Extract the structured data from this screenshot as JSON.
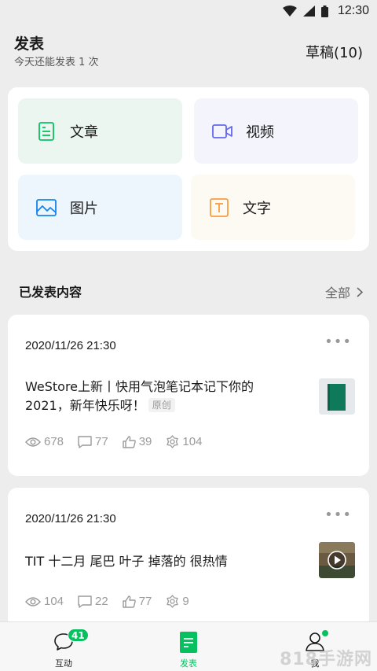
{
  "status_bar": {
    "time": "12:30"
  },
  "header": {
    "title": "发表",
    "subtitle": "今天还能发表 1 次",
    "drafts": "草稿(10)"
  },
  "publish_types": [
    {
      "label": "文章",
      "icon": "article-icon",
      "color": "#07c160"
    },
    {
      "label": "视频",
      "icon": "video-icon",
      "color": "#6467f0"
    },
    {
      "label": "图片",
      "icon": "image-icon",
      "color": "#1485ee"
    },
    {
      "label": "文字",
      "icon": "text-icon",
      "color": "#fa9d3b"
    }
  ],
  "published_section": {
    "title": "已发表内容",
    "view_all": "全部"
  },
  "posts": [
    {
      "date": "2020/11/26 21:30",
      "title": "WeStore上新丨快用气泡笔记本记下你的2021，新年快乐呀！",
      "badge": "原创",
      "views": "678",
      "comments": "77",
      "likes": "39",
      "shares": "104",
      "thumbnail": "green-notebook-thumbnail"
    },
    {
      "date": "2020/11/26 21:30",
      "title": "TIT 十二月 尾巴 叶子 掉落的 很热情",
      "badge": "",
      "views": "104",
      "comments": "22",
      "likes": "77",
      "shares": "9",
      "thumbnail": "video-thumbnail-with-play"
    }
  ],
  "tabbar": {
    "interact": {
      "label": "互动",
      "badge": "41"
    },
    "publish": {
      "label": "发表"
    },
    "me": {
      "label": "我"
    }
  },
  "watermark": "818手游网",
  "colors": {
    "accent": "#07c160",
    "background": "#ededed"
  }
}
